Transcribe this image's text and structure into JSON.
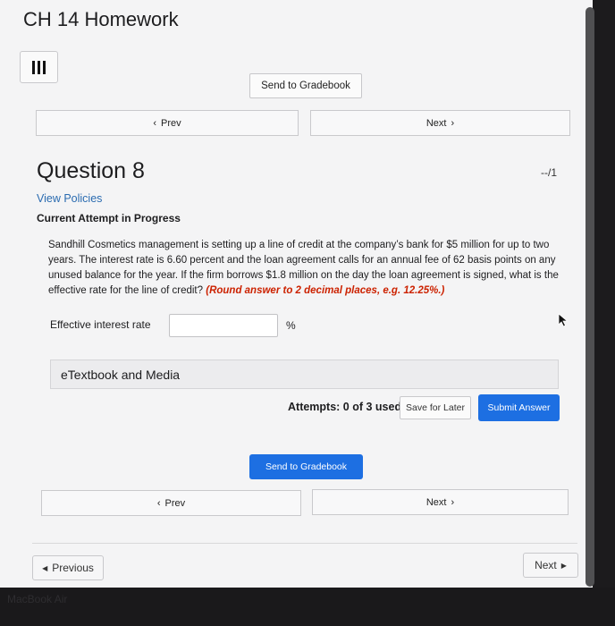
{
  "window": {
    "title": "CH 14 Homework"
  },
  "toolbar": {
    "send_to_gradebook": "Send to Gradebook"
  },
  "nav_top": {
    "prev": "Prev",
    "next": "Next"
  },
  "question": {
    "title": "Question 8",
    "score": "--/1",
    "view_policies": "View Policies",
    "attempt_status": "Current Attempt in Progress",
    "body": "Sandhill Cosmetics management is setting up a line of credit at the company’s bank for $5 million for up to two years. The interest rate is 6.60 percent and the loan agreement calls for an annual fee of 62 basis points on any unused balance for the year. If the firm borrows $1.8 million on the day the loan agreement is signed, what is the effective rate for the line of credit?",
    "hint": "(Round answer to 2 decimal places, e.g. 12.25%.)"
  },
  "answer": {
    "label": "Effective interest rate",
    "value": "",
    "unit": "%"
  },
  "etextbook": {
    "label": "eTextbook and Media"
  },
  "actions": {
    "attempts": "Attempts: 0 of 3 used",
    "save_later": "Save for Later",
    "submit": "Submit Answer",
    "send_to_gradebook": "Send to Gradebook"
  },
  "nav_bottom": {
    "prev": "Prev",
    "next": "Next"
  },
  "footer_nav": {
    "previous": "Previous",
    "next": "Next"
  },
  "bottom_strip": {
    "text": "MacBook Air"
  }
}
